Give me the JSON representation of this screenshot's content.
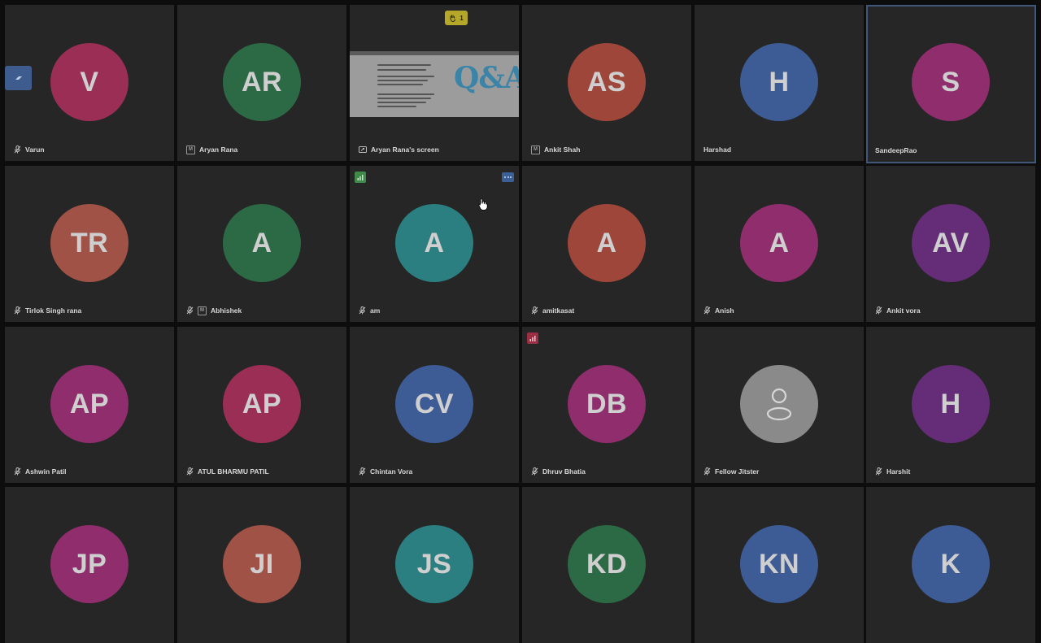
{
  "participants": [
    {
      "name": "Varun",
      "initials": "V",
      "color": "#9b2e55",
      "muted": true
    },
    {
      "name": "Aryan Rana",
      "initials": "AR",
      "color": "#2c6a45",
      "moderator": true
    },
    {
      "name": "Aryan Rana's screen",
      "screen": true
    },
    {
      "name": "Ankit Shah",
      "initials": "AS",
      "color": "#9f463b",
      "moderator": true
    },
    {
      "name": "Harshad",
      "initials": "H",
      "color": "#3d5b94"
    },
    {
      "name": "SandeepRao",
      "initials": "S",
      "color": "#8f2d6d",
      "active": true
    },
    {
      "name": "Tirlok Singh rana",
      "initials": "TR",
      "color": "#a05247",
      "muted": true
    },
    {
      "name": "Abhishek",
      "initials": "A",
      "color": "#2c6a45",
      "muted": true,
      "moderator": true
    },
    {
      "name": "am",
      "initials": "A",
      "color": "#2b7f80",
      "muted": true
    },
    {
      "name": "amitkasat",
      "initials": "A",
      "color": "#9f463b",
      "muted": true
    },
    {
      "name": "Anish",
      "initials": "A",
      "color": "#8f2d6d",
      "muted": true
    },
    {
      "name": "Ankit vora",
      "initials": "AV",
      "color": "#652d78",
      "muted": true
    },
    {
      "name": "Ashwin Patil",
      "initials": "AP",
      "color": "#8f2d6d",
      "muted": true
    },
    {
      "name": "ATUL BHARMU PATIL",
      "initials": "AP",
      "color": "#9b2e55",
      "muted": true
    },
    {
      "name": "Chintan Vora",
      "initials": "CV",
      "color": "#3d5b94",
      "muted": true
    },
    {
      "name": "Dhruv Bhatia",
      "initials": "DB",
      "color": "#8f2d6d",
      "muted": true
    },
    {
      "name": "Fellow Jitster",
      "initials": "",
      "color": "#8a8a8a",
      "muted": true,
      "placeholder": true
    },
    {
      "name": "Harshit",
      "initials": "H",
      "color": "#652d78",
      "muted": true
    },
    {
      "name": "",
      "initials": "JP",
      "color": "#8f2d6d"
    },
    {
      "name": "",
      "initials": "JI",
      "color": "#a05247"
    },
    {
      "name": "",
      "initials": "JS",
      "color": "#2b7f80"
    },
    {
      "name": "",
      "initials": "KD",
      "color": "#2c6a45"
    },
    {
      "name": "",
      "initials": "KN",
      "color": "#3d5b94"
    },
    {
      "name": "",
      "initials": "K",
      "color": "#3d5b94"
    }
  ],
  "raised_hand": {
    "icon": "hand-icon",
    "count": "1"
  },
  "connection_indicators": {
    "good": "#3f8a48",
    "poor": "#9a2e43"
  },
  "shared_screen": {
    "big_text": "Q&A"
  }
}
